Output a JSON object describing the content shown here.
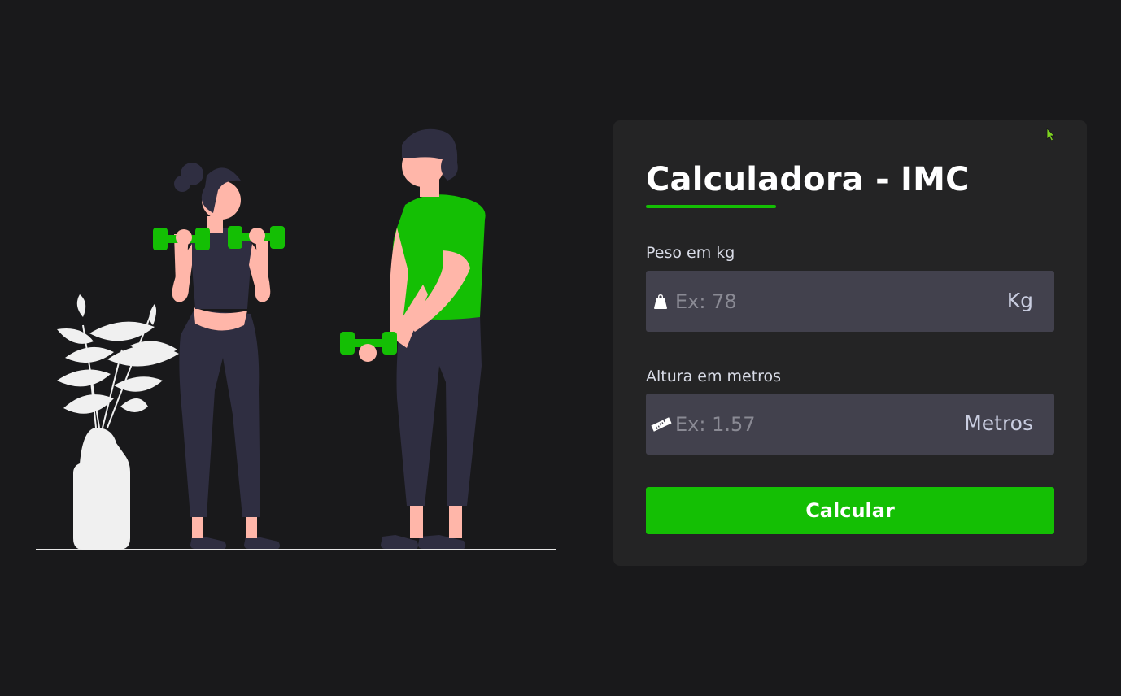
{
  "colors": {
    "background": "#19191b",
    "card": "#242425",
    "accent": "#14bf04",
    "input_background": "#42414d",
    "skin": "#ffb6a9",
    "dark_clothes": "#2f2e41",
    "plant": "#f0f0f0"
  },
  "illustration": {
    "subject": "two people lifting green dumbbells beside a potted plant",
    "icon": "workout-illustration"
  },
  "calculator": {
    "title": "Calculadora - IMC",
    "weight": {
      "label": "Peso em kg",
      "placeholder": "Ex: 78",
      "value": "",
      "unit": "Kg",
      "icon": "weight-icon"
    },
    "height": {
      "label": "Altura em metros",
      "placeholder": "Ex: 1.57",
      "value": "",
      "unit": "Metros",
      "icon": "ruler-icon"
    },
    "button_label": "Calcular"
  }
}
